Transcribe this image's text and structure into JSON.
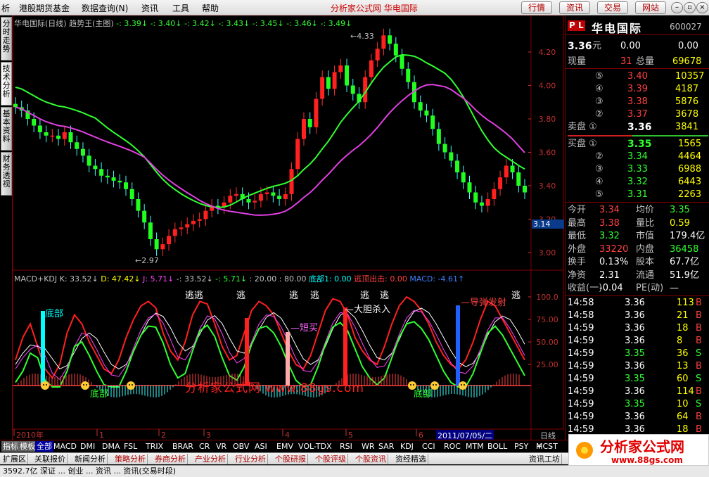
{
  "menubar": {
    "items": [
      "析",
      "港股期货基金",
      "数据查询(N)",
      "资讯",
      "工具",
      "帮助"
    ],
    "site_title": "分析家公式网 华电国际",
    "buttons": [
      "行情",
      "资讯",
      "交易",
      "网站"
    ]
  },
  "side_tabs": [
    "分时走势",
    "技术分析",
    "基本资料",
    "财务透视"
  ],
  "main_chart": {
    "header": [
      {
        "text": "华电国际(日线) 趋势王(主图)",
        "color": "#c0c0c0"
      },
      {
        "text": " -: 3.39↓",
        "color": "#30ff30"
      },
      {
        "text": "  -: 3.40↓",
        "color": "#30ff30"
      },
      {
        "text": "  -: 3.42↓",
        "color": "#30ff30"
      },
      {
        "text": "  -: 3.43↓",
        "color": "#30ff30"
      },
      {
        "text": "  -: 3.45↓",
        "color": "#30ff30"
      },
      {
        "text": "  -: 3.46↓",
        "color": "#30ff30"
      },
      {
        "text": "  -: 3.49↓",
        "color": "#30ff30"
      }
    ],
    "y_ticks": [
      "4.20",
      "4.00",
      "3.80",
      "3.60",
      "3.40",
      "3.20",
      "3.00"
    ],
    "price_tag": "3.14",
    "annotations": {
      "high": "4.33",
      "low": "2.97"
    }
  },
  "indicator_chart": {
    "header": [
      {
        "text": "MACD+KDJ K: 33.52↓",
        "color": "#c0c0c0"
      },
      {
        "text": "  D: 47.42↓",
        "color": "#ffff00"
      },
      {
        "text": "  J: 5.71↓",
        "color": "#ff40ff"
      },
      {
        "text": "  -: 33.52↓",
        "color": "#c0c0c0"
      },
      {
        "text": "  -: 5.71↓",
        "color": "#30ff30"
      },
      {
        "text": "  : 20.00",
        "color": "#c0c0c0"
      },
      {
        "text": "  : 80.00",
        "color": "#c0c0c0"
      },
      {
        "text": "  底部1: 0.00",
        "color": "#00ffff"
      },
      {
        "text": "      逃顶出击: 0.00",
        "color": "#ff4040"
      },
      {
        "text": "  MACD: -4.61↑",
        "color": "#4080ff"
      }
    ],
    "y_ticks": [
      "100.0",
      "75.00",
      "50.00",
      "25.00"
    ],
    "labels": {
      "bottom": "底部",
      "escape": "逃",
      "escape2": "逃逃",
      "short_buy": "短买",
      "bold_buy": "大胆杀入",
      "guide_up": "导弹发射",
      "bottom2": "底部"
    }
  },
  "time_axis": [
    "2010年",
    "1",
    "2",
    "3",
    "4",
    "5",
    "6"
  ],
  "date_highlight": "2011/07/05/二",
  "period": "日线",
  "watermark": "分析家公式网 www.88gs.com",
  "quote": {
    "badge": "P L",
    "name": "华电国际",
    "code": "600027",
    "price": "3.36",
    "price_unit": "元",
    "change": "0.00",
    "change_pct": "0.00",
    "now_label": "现量",
    "now_vol": "31",
    "total_label": "总量",
    "total_vol": "69678",
    "asks": [
      {
        "level": "⑤",
        "price": "3.40",
        "vol": "10357"
      },
      {
        "level": "④",
        "price": "3.39",
        "vol": "4187"
      },
      {
        "level": "③",
        "price": "3.38",
        "vol": "5876"
      },
      {
        "level": "②",
        "price": "3.37",
        "vol": "3678"
      },
      {
        "level": "卖盘 ①",
        "price": "3.36",
        "vol": "3841"
      }
    ],
    "bids": [
      {
        "level": "买盘 ①",
        "price": "3.35",
        "vol": "1565"
      },
      {
        "level": "②",
        "price": "3.34",
        "vol": "4464"
      },
      {
        "level": "③",
        "price": "3.33",
        "vol": "6988"
      },
      {
        "level": "④",
        "price": "3.32",
        "vol": "6443"
      },
      {
        "level": "⑤",
        "price": "3.31",
        "vol": "2263"
      }
    ],
    "stats": [
      {
        "l1": "今开",
        "v1": "3.34",
        "c1": "#ff4040",
        "l2": "均价",
        "v2": "3.35",
        "c2": "#30ff30"
      },
      {
        "l1": "最高",
        "v1": "3.38",
        "c1": "#ff4040",
        "l2": "量比",
        "v2": "0.59",
        "c2": "#ffff00"
      },
      {
        "l1": "最低",
        "v1": "3.32",
        "c1": "#30ff30",
        "l2": "市值",
        "v2": "179.4亿",
        "c2": "#ffffff"
      },
      {
        "l1": "外盘",
        "v1": "33220",
        "c1": "#ff4040",
        "l2": "内盘",
        "v2": "36458",
        "c2": "#30ff30"
      },
      {
        "l1": "换手",
        "v1": "0.13%",
        "c1": "#ffffff",
        "l2": "股本",
        "v2": "67.7亿",
        "c2": "#ffffff"
      },
      {
        "l1": "净资",
        "v1": "2.31",
        "c1": "#ffffff",
        "l2": "流通",
        "v2": "51.9亿",
        "c2": "#ffffff"
      },
      {
        "l1": "收益(一)",
        "v1": "-0.04",
        "c1": "#ffffff",
        "l2": "PE(动)",
        "v2": "—",
        "c2": "#ffffff"
      }
    ],
    "ticks": [
      {
        "time": "14:58",
        "price": "3.36",
        "vol": "113",
        "side": "B"
      },
      {
        "time": "14:58",
        "price": "3.36",
        "vol": "21",
        "side": "B"
      },
      {
        "time": "14:59",
        "price": "3.36",
        "vol": "18",
        "side": "B"
      },
      {
        "time": "14:59",
        "price": "3.36",
        "vol": "8",
        "side": "B"
      },
      {
        "time": "14:59",
        "price": "3.35",
        "vol": "36",
        "side": "S"
      },
      {
        "time": "14:59",
        "price": "3.36",
        "vol": "13",
        "side": "B"
      },
      {
        "time": "14:59",
        "price": "3.35",
        "vol": "60",
        "side": "S"
      },
      {
        "time": "14:59",
        "price": "3.36",
        "vol": "114",
        "side": "B"
      },
      {
        "time": "14:59",
        "price": "3.35",
        "vol": "10",
        "side": "S"
      },
      {
        "time": "14:59",
        "price": "3.36",
        "vol": "64",
        "side": "B"
      },
      {
        "time": "14:59",
        "price": "3.36",
        "vol": "18",
        "side": "B"
      }
    ]
  },
  "indicator_tabs": [
    "指标",
    "模板",
    "全部",
    "MACD",
    "DMI",
    "DMA",
    "FSL",
    "TRIX",
    "BRAR",
    "CR",
    "VR",
    "OBV",
    "ASI",
    "EMV",
    "VOL-TDX",
    "RSI",
    "WR",
    "SAR",
    "KDJ",
    "CCI",
    "ROC",
    "MTM",
    "BOLL",
    "PSY",
    "MCST"
  ],
  "indicator_nav": [
    "+",
    "-"
  ],
  "bottom_tabs": [
    "扩展区",
    "关联报价",
    "新闻分析",
    "策略分析",
    "券商分析",
    "产业分析",
    "行业分析",
    "个股研报",
    "个股评级",
    "个股资讯",
    "资经精选"
  ],
  "bottom_right_tab": "资讯工坊",
  "logo": {
    "text": "分析家公式网",
    "url": "www.88gs.com"
  },
  "status_text": "3592.7亿  深证  ...  创业  ...  资讯  ...  资讯(交易时段)"
}
